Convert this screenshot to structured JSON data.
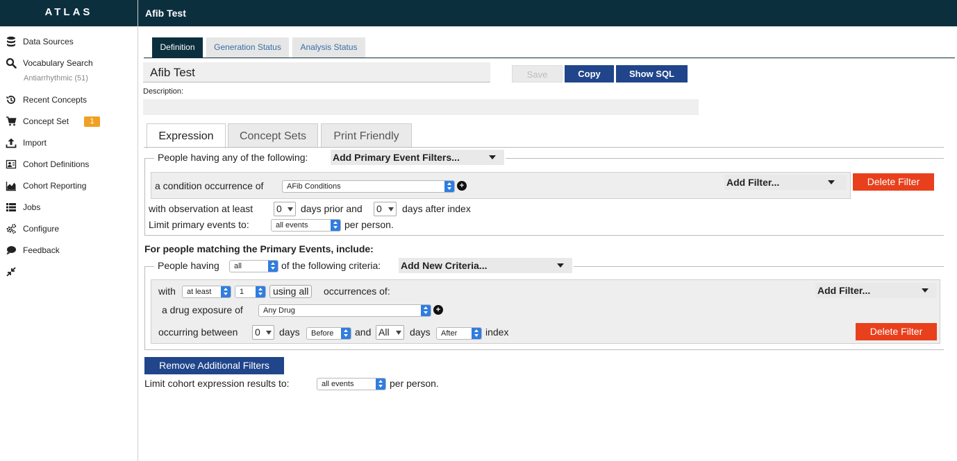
{
  "app": {
    "brand": "ATLAS",
    "page_title": "Afib Test"
  },
  "sidebar": {
    "items": [
      {
        "label": "Data Sources",
        "icon": "database-icon"
      },
      {
        "label": "Vocabulary Search",
        "icon": "search-icon"
      },
      {
        "label": "Recent Concepts",
        "icon": "history-icon"
      },
      {
        "label": "Concept Set",
        "icon": "cart-icon"
      },
      {
        "label": "Import",
        "icon": "upload-icon"
      },
      {
        "label": "Cohort Definitions",
        "icon": "users-icon"
      },
      {
        "label": "Cohort Reporting",
        "icon": "area-chart-icon"
      },
      {
        "label": "Jobs",
        "icon": "list-icon"
      },
      {
        "label": "Configure",
        "icon": "cogs-icon"
      },
      {
        "label": "Feedback",
        "icon": "comment-icon"
      }
    ],
    "vocab_sub": "Antiarrhythmic (51)",
    "concept_set_badge": "1",
    "collapse_icon": "compress-icon"
  },
  "tabs": {
    "primary": [
      "Definition",
      "Generation Status",
      "Analysis Status"
    ],
    "secondary": [
      "Expression",
      "Concept Sets",
      "Print Friendly"
    ]
  },
  "cohort": {
    "name": "Afib Test",
    "description_label": "Description:",
    "description": "",
    "buttons": {
      "save": "Save",
      "copy": "Copy",
      "show_sql": "Show SQL"
    }
  },
  "primary": {
    "legend": "People having any of the following:",
    "filters_dropdown": "Add Primary Event Filters...",
    "condition_label": "a condition occurrence of",
    "condition_value": "AFib Conditions",
    "add_filter": "Add Filter...",
    "delete_filter": "Delete Filter",
    "obs_prefix": "with observation at least",
    "obs_prior_value": "0",
    "obs_prior_suffix": "days prior and",
    "obs_after_value": "0",
    "obs_after_suffix": "days after index",
    "limit_prefix": "Limit primary events to:",
    "limit_value": "all events",
    "limit_suffix": "per person."
  },
  "inclusion": {
    "heading": "For people matching the Primary Events, include:",
    "people_having": "People having",
    "people_value": "all",
    "criteria_text": "of the following criteria:",
    "add_criteria": "Add New Criteria...",
    "with": "with",
    "at_least_value": "at least",
    "count_value": "1",
    "using_all": "using all",
    "occurrences_of": "occurrences of:",
    "add_filter": "Add Filter...",
    "drug_label": "a drug exposure of",
    "drug_value": "Any Drug",
    "occurring_between": "occurring between",
    "days_before_value": "0",
    "days_word": "days",
    "before_value": "Before",
    "and_word": "and",
    "all_value": "All",
    "after_days_word": "days",
    "after_value": "After",
    "index_word": "index",
    "delete_filter": "Delete Filter"
  },
  "footer": {
    "remove_filters": "Remove Additional Filters",
    "limit_prefix": "Limit cohort expression results to:",
    "limit_value": "all events",
    "limit_suffix": "per person."
  },
  "colors": {
    "navy": "#0c2f3e",
    "blue_button": "#20458a",
    "red_button": "#e8401c",
    "badge": "#f0a024",
    "select_accent": "#2f7de1"
  }
}
